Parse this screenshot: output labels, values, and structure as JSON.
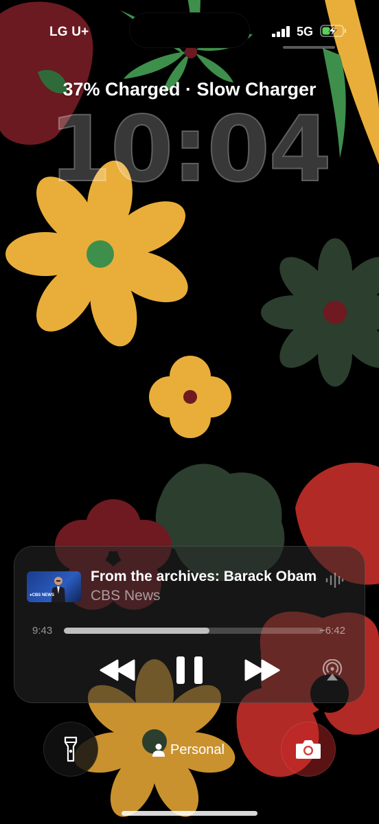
{
  "status_bar": {
    "carrier": "LG U+",
    "network": "5G",
    "signal_bars": 4,
    "battery_state": "charging"
  },
  "lock_screen": {
    "charge_status": "37% Charged · Slow Charger",
    "time": "10:04"
  },
  "now_playing": {
    "title": "From the archives: Barack Obama",
    "source": "CBS News",
    "artwork_logo": "●CBS NEWS",
    "elapsed": "9:43",
    "remaining": "−6:42",
    "progress_fraction": 0.56,
    "controls": {
      "rewind": "rewind-icon",
      "pause": "pause-icon",
      "forward": "fast-forward-icon",
      "airplay": "airplay-audio-icon"
    }
  },
  "bottom": {
    "focus_label": "Personal",
    "flashlight": "flashlight-icon",
    "camera": "camera-icon"
  },
  "colors": {
    "flower_yellow": "#E9AE3A",
    "flower_green": "#3E8F4C",
    "flower_dark_green": "#2C3E2E",
    "flower_red": "#B22A25",
    "flower_maroon": "#6E1A20"
  }
}
